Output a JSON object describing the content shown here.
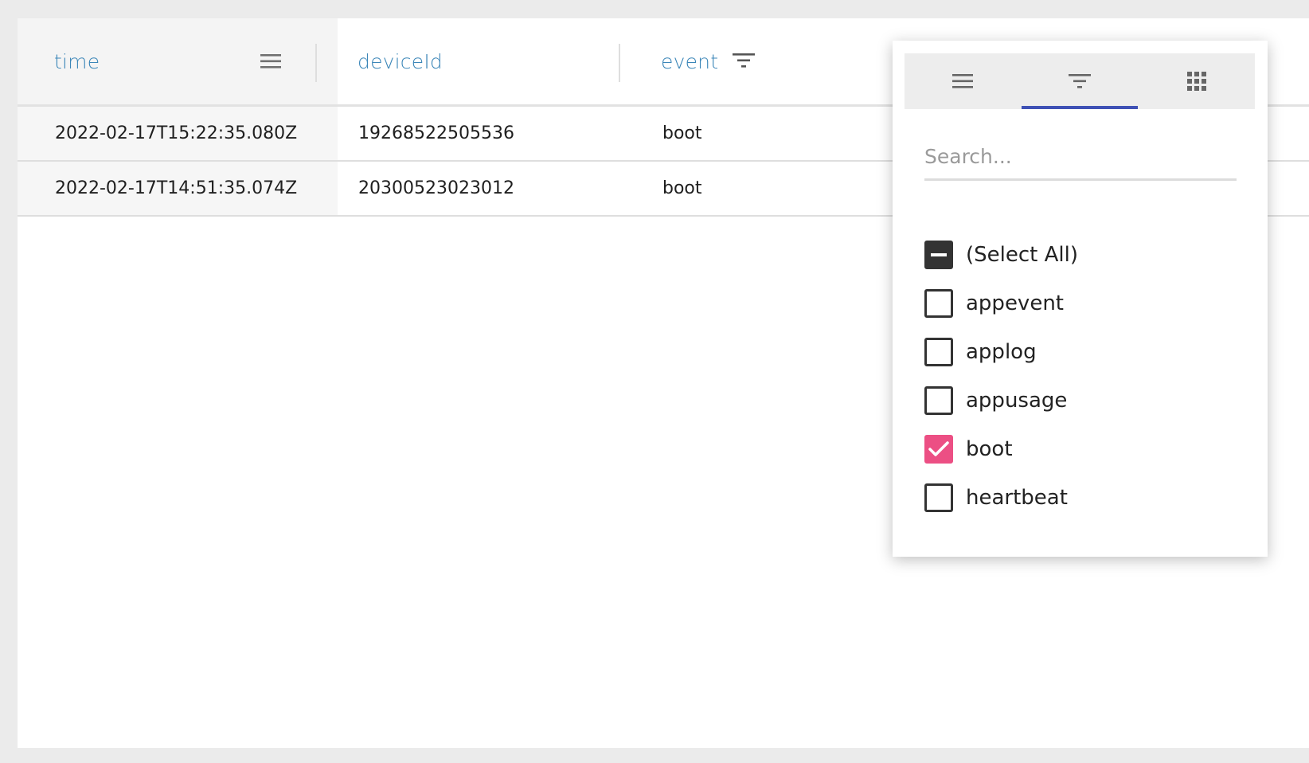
{
  "columns": [
    {
      "label": "time",
      "icon": "menu-icon"
    },
    {
      "label": "deviceId"
    },
    {
      "label": "event",
      "icon": "filter-icon"
    }
  ],
  "rows": [
    {
      "time": "2022-02-17T15:22:35.080Z",
      "deviceId": "19268522505536",
      "event": "boot"
    },
    {
      "time": "2022-02-17T14:51:35.074Z",
      "deviceId": "20300523023012",
      "event": "boot"
    }
  ],
  "filter_popup": {
    "tabs": [
      {
        "icon": "menu-icon",
        "active": false
      },
      {
        "icon": "filter-icon",
        "active": true
      },
      {
        "icon": "columns-grid-icon",
        "active": false
      }
    ],
    "search": {
      "placeholder": "Search...",
      "value": ""
    },
    "options": [
      {
        "label": "(Select All)",
        "state": "indeterminate"
      },
      {
        "label": "appevent",
        "state": "unchecked"
      },
      {
        "label": "applog",
        "state": "unchecked"
      },
      {
        "label": "appusage",
        "state": "unchecked"
      },
      {
        "label": "boot",
        "state": "checked"
      },
      {
        "label": "heartbeat",
        "state": "unchecked"
      }
    ]
  },
  "colors": {
    "header_text": "#3b86b8",
    "tab_underline": "#3f51b5",
    "checked": "#ec4f84",
    "indeterminate": "#333333"
  }
}
